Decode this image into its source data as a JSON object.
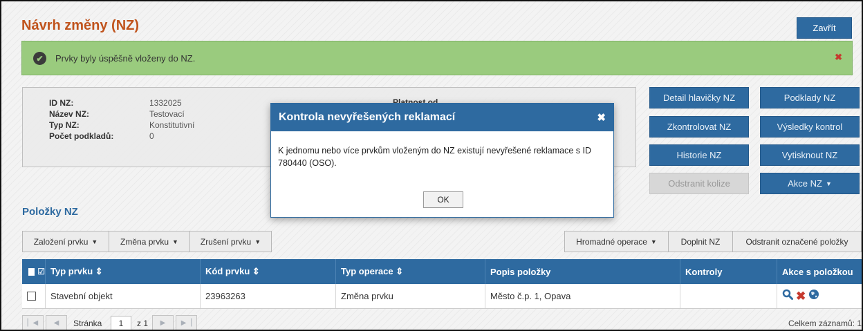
{
  "page": {
    "title": "Návrh změny (NZ)",
    "close_label": "Zavřít"
  },
  "alert": {
    "icon": "check-circle-icon",
    "text": "Prvky byly úspěšně vloženy do NZ.",
    "close_glyph": "✖"
  },
  "info": {
    "rows": [
      {
        "label": "ID NZ:",
        "value": "1332025"
      },
      {
        "label": "Název NZ:",
        "value": "Testovací"
      },
      {
        "label": "Typ NZ:",
        "value": "Konstitutivní"
      },
      {
        "label": "Počet podkladů:",
        "value": "0"
      }
    ],
    "center_label": "Platnost od"
  },
  "side_buttons": {
    "detail": "Detail hlavičky NZ",
    "podklady": "Podklady NZ",
    "zkontrolovat": "Zkontrolovat NZ",
    "vysledky": "Výsledky kontrol",
    "historie": "Historie NZ",
    "vytisknout": "Vytisknout NZ",
    "odstranit_kolize": "Odstranit kolize",
    "akce": "Akce NZ"
  },
  "items": {
    "title": "Položky NZ",
    "toolbar": {
      "zalozeni": "Založení prvku",
      "zmena": "Změna prvku",
      "zruseni": "Zrušení prvku",
      "hromadne": "Hromadné operace",
      "doplnit": "Doplnit NZ",
      "odstranit": "Odstranit označené položky"
    },
    "columns": [
      "Typ prvku ⇕",
      "Kód prvku ⇕",
      "Typ operace ⇕",
      "Popis položky",
      "Kontroly",
      "Akce s položkou"
    ],
    "rows": [
      {
        "typ": "Stavební objekt",
        "kod": "23963263",
        "operace": "Změna prvku",
        "popis": "Město č.p. 1, Opava",
        "kontroly": ""
      }
    ],
    "pager": {
      "page_label": "Stránka",
      "page_value": "1",
      "of_label": "z 1",
      "total": "Celkem záznamů: 1"
    }
  },
  "modal": {
    "title": "Kontrola nevyřešených reklamací",
    "close_glyph": "✖",
    "body": "K jednomu nebo více prvkům vloženým do NZ existují nevyřešené reklamace s ID 780440 (OSO).",
    "ok_label": "OK"
  },
  "colors": {
    "accent": "#2e6aa0",
    "title": "#c0531c",
    "success": "#9acb7e",
    "danger": "#c63a2f"
  }
}
